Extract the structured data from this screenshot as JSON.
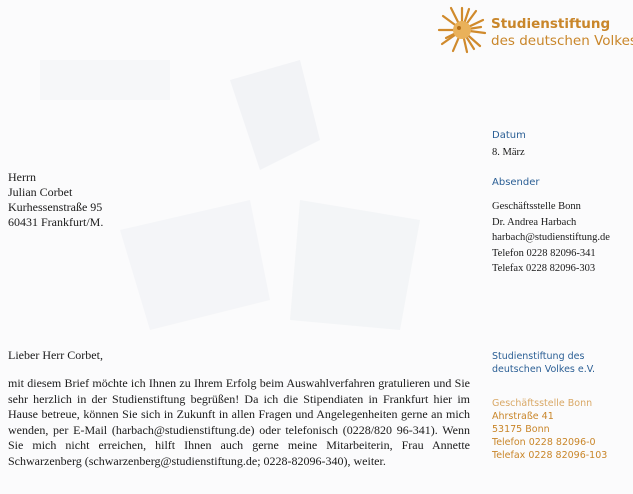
{
  "logo": {
    "icon": "sunburst-head-logo-icon",
    "line1": "Studienstiftung",
    "line2": "des deutschen Volkes",
    "color": "#c9862a"
  },
  "meta": {
    "datum_label": "Datum",
    "datum_value": "8. März",
    "absender_label": "Absender",
    "absender_lines": [
      "Geschäftsstelle Bonn",
      "Dr. Andrea Harbach",
      "harbach@studienstiftung.de",
      "Telefon 0228 82096-341",
      "Telefax 0228 82096-303"
    ]
  },
  "recipient": {
    "lines": [
      "Herrn",
      "Julian Corbet",
      "Kurhessenstraße 95",
      "60431 Frankfurt/M."
    ]
  },
  "letter": {
    "greeting": "Lieber Herr Corbet,",
    "body": "mit diesem Brief möchte ich Ihnen zu Ihrem Erfolg beim Auswahlverfahren gratulieren und Sie sehr herzlich in der Studienstiftung begrüßen! Da ich die Stipendiaten in Frankfurt hier im Hause betreue, können Sie sich in Zukunft in allen Fragen und Angelegenheiten gerne an mich wenden, per E-Mail (harbach@studienstiftung.de) oder telefonisch (0228/820 96-341). Wenn Sie mich nicht erreichen, hilft Ihnen auch gerne meine Mitarbeiterin, Frau Annette Schwarzenberg (schwarzenberg@studienstiftung.de; 0228-82096-340), weiter."
  },
  "footer": {
    "org_line1": "Studienstiftung des",
    "org_line2": "deutschen Volkes e.V.",
    "office_title": "Geschäftsstelle Bonn",
    "office_lines": [
      "Ahrstraße 41",
      "53175 Bonn",
      "Telefon 0228 82096-0",
      "Telefax 0228 82096-103"
    ]
  }
}
